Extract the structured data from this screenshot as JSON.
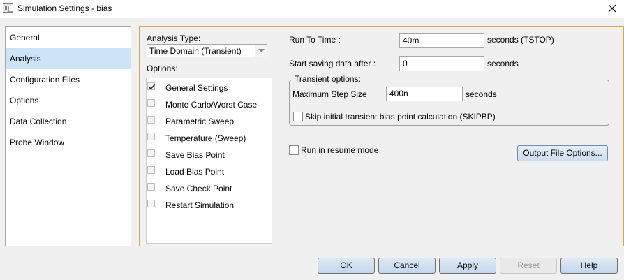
{
  "window": {
    "title": "Simulation Settings - bias"
  },
  "nav": {
    "items": [
      {
        "label": "General"
      },
      {
        "label": "Analysis",
        "selected": true
      },
      {
        "label": "Configuration Files"
      },
      {
        "label": "Options"
      },
      {
        "label": "Data Collection"
      },
      {
        "label": "Probe Window"
      }
    ]
  },
  "analysis": {
    "type_label": "Analysis Type:",
    "type_value": "Time Domain (Transient)",
    "options_label": "Options:",
    "options": [
      {
        "label": "General Settings",
        "checked": true
      },
      {
        "label": "Monte Carlo/Worst Case",
        "checked": false
      },
      {
        "label": "Parametric Sweep",
        "checked": false
      },
      {
        "label": "Temperature (Sweep)",
        "checked": false
      },
      {
        "label": "Save Bias Point",
        "checked": false
      },
      {
        "label": "Load Bias Point",
        "checked": false
      },
      {
        "label": "Save Check Point",
        "checked": false
      },
      {
        "label": "Restart Simulation",
        "checked": false
      }
    ]
  },
  "transient": {
    "run_to_time_label": "Run To Time :",
    "run_to_time_value": "40m",
    "run_to_time_unit": "seconds (TSTOP)",
    "start_saving_label": "Start saving data after :",
    "start_saving_value": "0",
    "start_saving_unit": "seconds",
    "group_title": "Transient options:",
    "max_step_label": "Maximum Step Size",
    "max_step_value": "400n",
    "max_step_unit": "seconds",
    "skip_bias_label": "Skip initial transient bias point calculation (SKIPBP)",
    "skip_bias_checked": false,
    "resume_label": "Run in resume mode",
    "resume_checked": false,
    "output_file_options_label": "Output File Options..."
  },
  "buttons": {
    "ok": "OK",
    "cancel": "Cancel",
    "apply": "Apply",
    "reset": "Reset",
    "help": "Help"
  },
  "colors": {
    "nav_selected": "#cce4f7",
    "panel_border": "#d9a54f",
    "button_gradient_top": "#dfe9f5",
    "button_gradient_bottom": "#c3d6ec"
  }
}
